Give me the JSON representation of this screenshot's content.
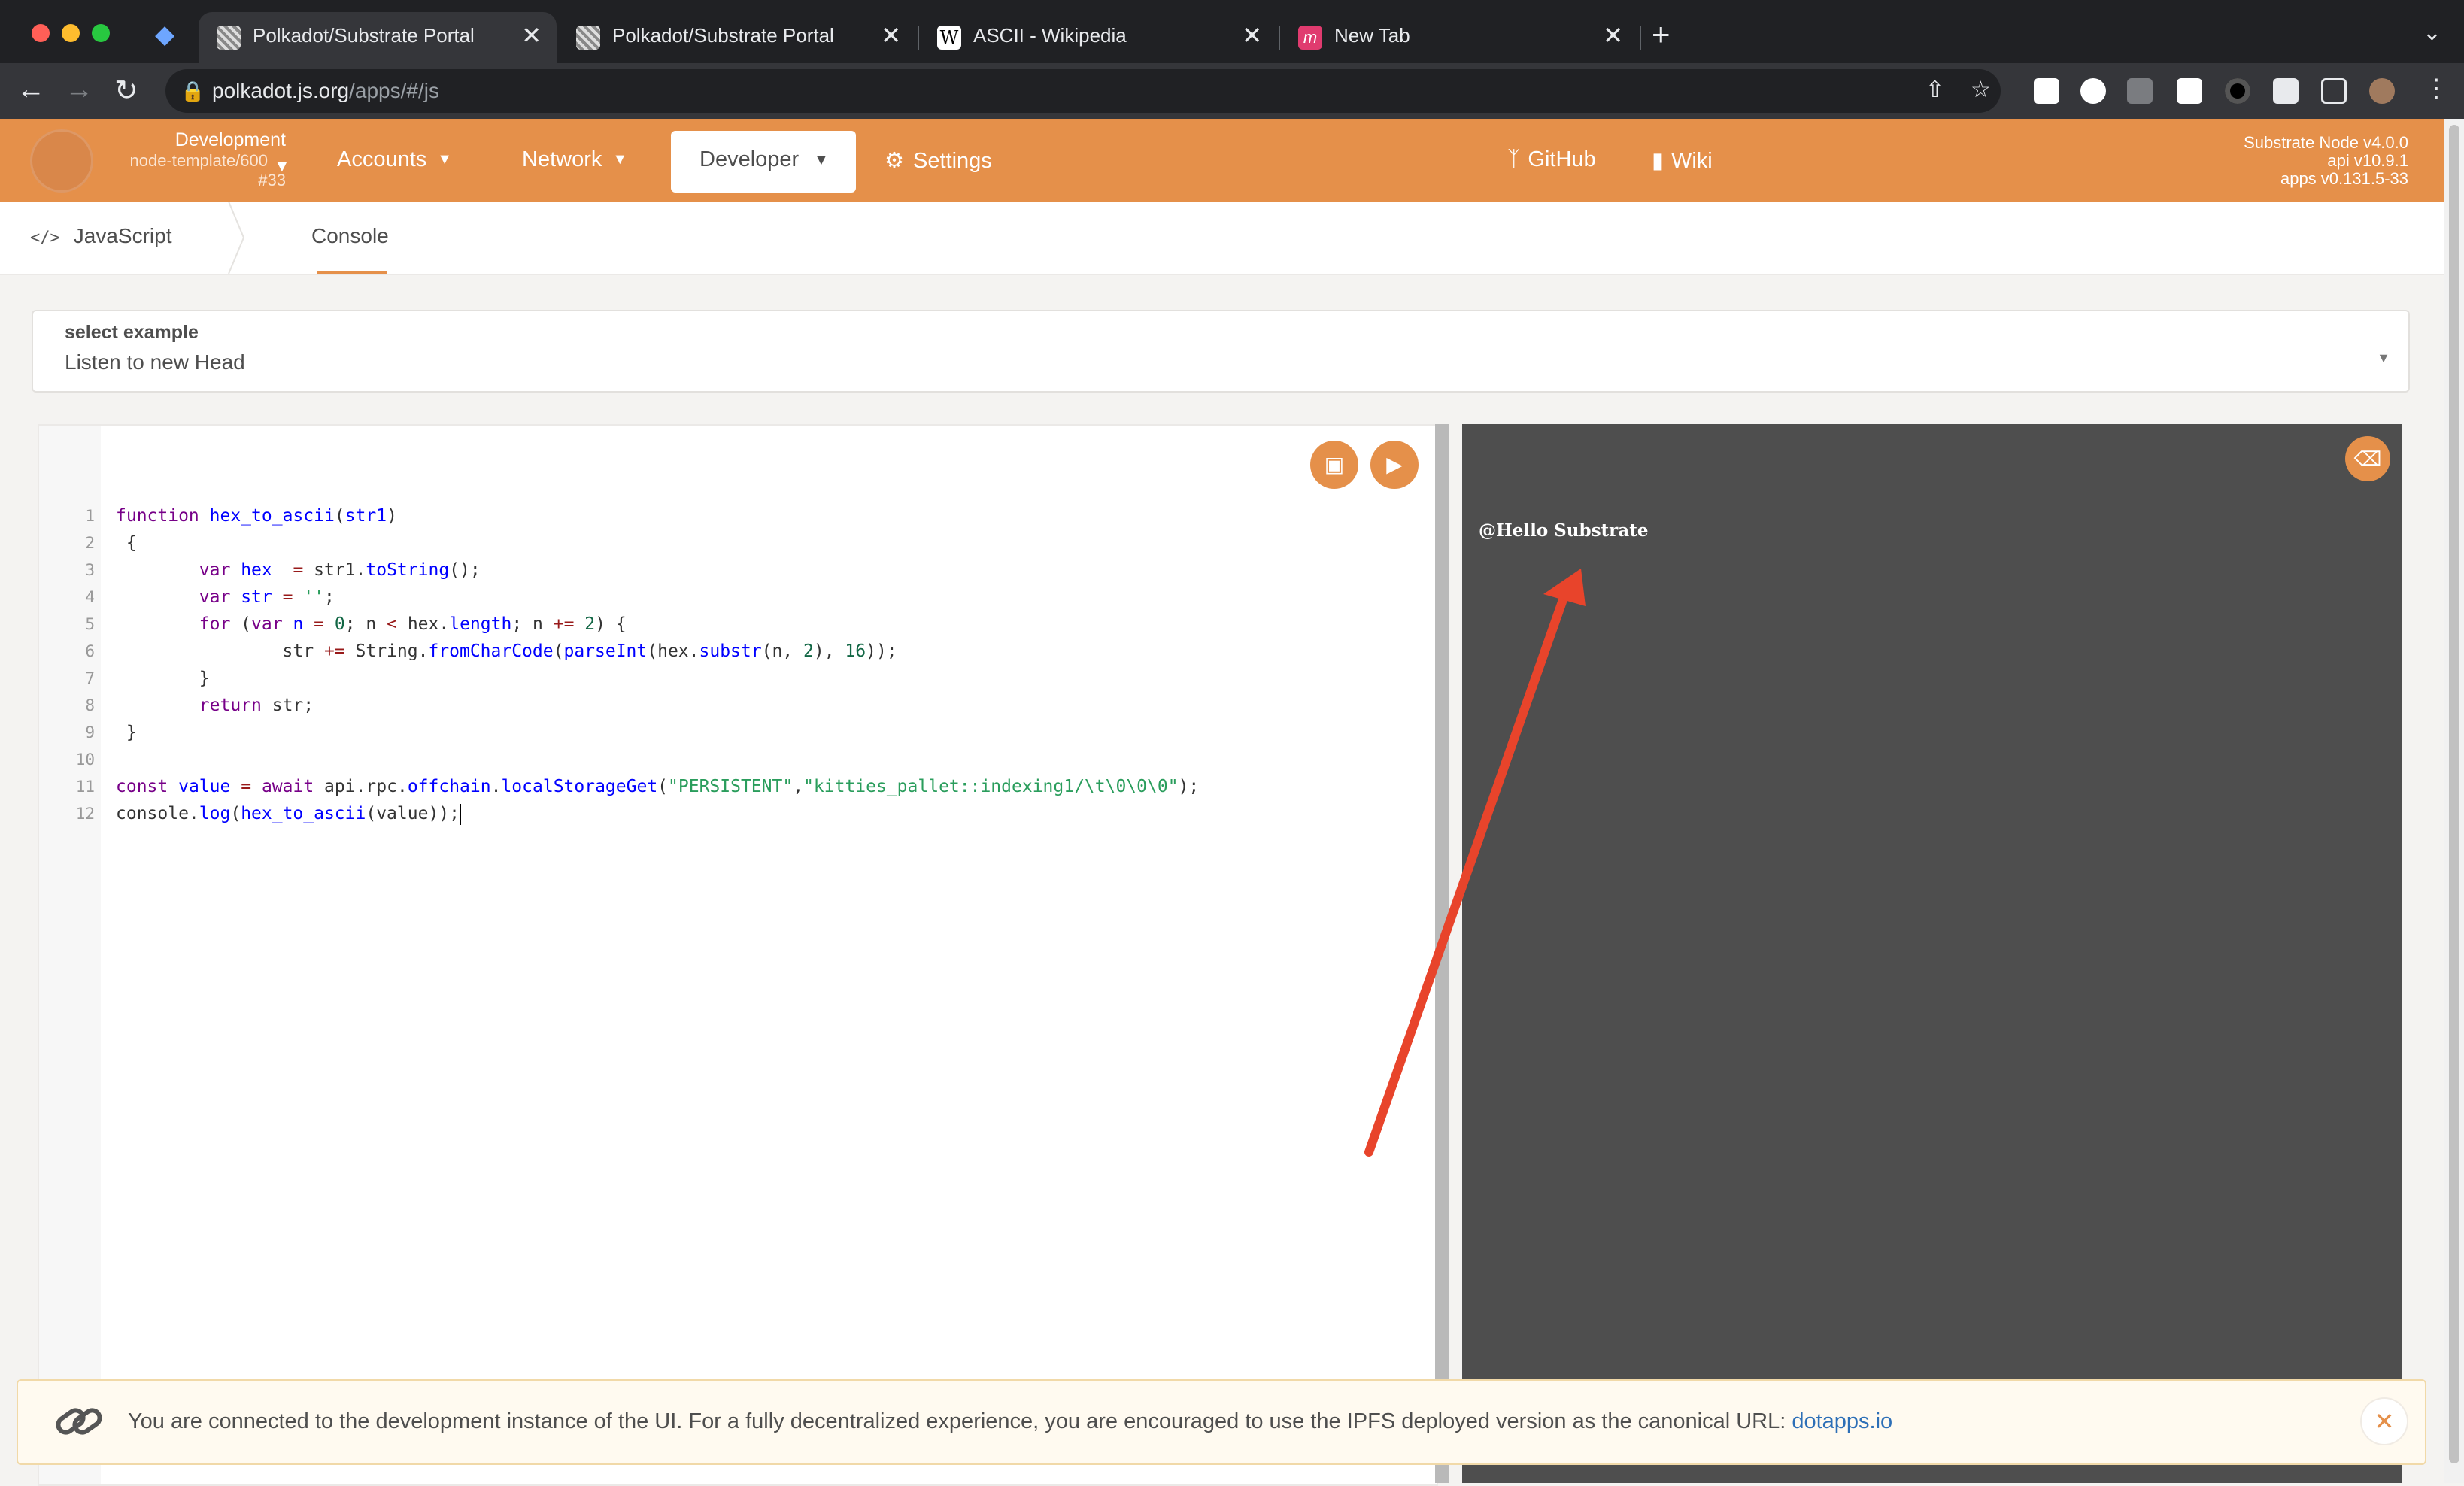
{
  "browser": {
    "tabs": [
      {
        "title": "Polkadot/Substrate Portal",
        "active": true
      },
      {
        "title": "Polkadot/Substrate Portal",
        "active": false
      },
      {
        "title": "ASCII - Wikipedia",
        "active": false
      },
      {
        "title": "New Tab",
        "active": false
      }
    ],
    "url_host": "polkadot.js.org",
    "url_path": "/apps/#/js",
    "new_tab_symbol": "+",
    "close_symbol": "✕"
  },
  "header": {
    "chain": {
      "name": "Development",
      "node": "node-template/600",
      "block": "#33"
    },
    "menu": {
      "accounts": "Accounts",
      "network": "Network",
      "developer": "Developer",
      "settings": "Settings",
      "github": "GitHub",
      "wiki": "Wiki"
    },
    "version": {
      "node": "Substrate Node v4.0.0",
      "api": "api v10.9.1",
      "apps": "apps v0.131.5-33"
    },
    "accent_color": "#e5904a"
  },
  "subtabs": {
    "javascript": "JavaScript",
    "console": "Console"
  },
  "example": {
    "label": "select example",
    "value": "Listen to new Head"
  },
  "editor": {
    "line_numbers": [
      "1",
      "2",
      "3",
      "4",
      "5",
      "6",
      "7",
      "8",
      "9",
      "10",
      "11",
      "12"
    ],
    "code": [
      "function hex_to_ascii(str1)",
      " {",
      "        var hex  = str1.toString();",
      "        var str = '';",
      "        for (var n = 0; n < hex.length; n += 2) {",
      "                str += String.fromCharCode(parseInt(hex.substr(n, 2), 16));",
      "        }",
      "        return str;",
      " }",
      "",
      "const value = await api.rpc.offchain.localStorageGet(\"PERSISTENT\",\"kitties_pallet::indexing1/\\t\\0\\0\\0\");",
      "console.log(hex_to_ascii(value));"
    ]
  },
  "output": {
    "log": "@Hello Substrate"
  },
  "banner": {
    "message": "You are connected to the development instance of the UI. For a fully decentralized experience, you are encouraged to use the IPFS deployed version as the canonical URL: ",
    "link": "dotapps.io"
  }
}
